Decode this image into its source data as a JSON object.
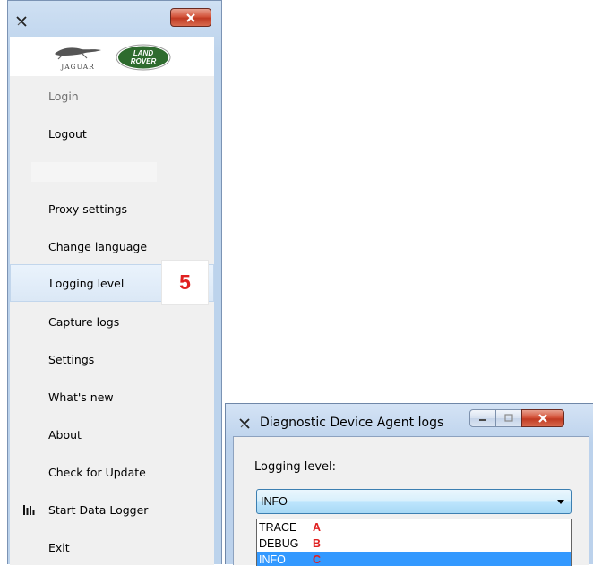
{
  "menu_window": {
    "app_icon": "x-logo-icon",
    "close_icon": "close-icon",
    "logos": {
      "jaguar_text": "JAGUAR",
      "landrover_line1": "LAND",
      "landrover_line2": "ROVER"
    },
    "items": [
      {
        "label": "Login",
        "enabled": false
      },
      {
        "label": "Logout",
        "enabled": true
      },
      {
        "label": "Proxy settings",
        "enabled": true
      },
      {
        "label": "Change language",
        "enabled": true
      },
      {
        "label": "Logging level",
        "enabled": true,
        "highlighted": true
      },
      {
        "label": "Capture logs",
        "enabled": true
      },
      {
        "label": "Settings",
        "enabled": true
      },
      {
        "label": "What's new",
        "enabled": true
      },
      {
        "label": "About",
        "enabled": true
      },
      {
        "label": "Check for Update",
        "enabled": true
      },
      {
        "label": "Start Data Logger",
        "enabled": true,
        "icon": "bar-chart-icon"
      },
      {
        "label": "Exit",
        "enabled": true
      }
    ]
  },
  "step_badge": "5",
  "log_window": {
    "title": "Diagnostic Device Agent logs",
    "logging_level_label": "Logging level:",
    "selected_value": "INFO",
    "options": [
      {
        "label": "TRACE",
        "marker": "A"
      },
      {
        "label": "DEBUG",
        "marker": "B"
      },
      {
        "label": "INFO",
        "marker": "C",
        "selected": true
      }
    ]
  },
  "colors": {
    "highlight_red": "#e02020",
    "selection_blue": "#3399ff",
    "window_frame": "#bcd3ec",
    "landrover_green": "#2e6b2e"
  }
}
